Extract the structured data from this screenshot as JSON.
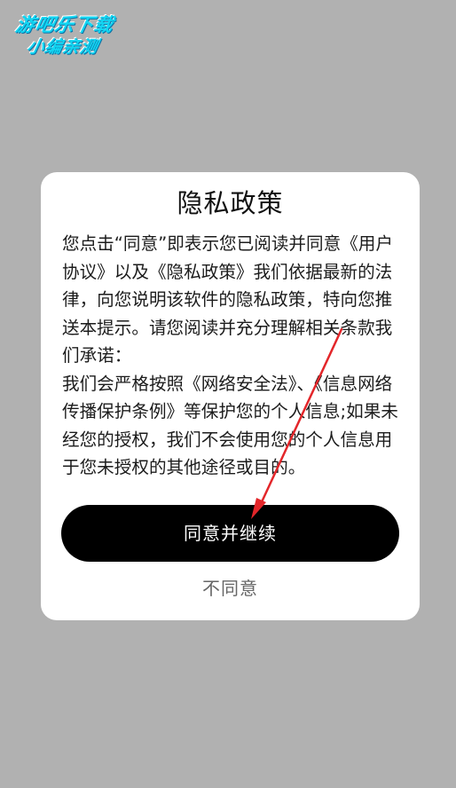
{
  "watermark": {
    "line1": "游吧乐下载",
    "line2": "小编亲测"
  },
  "dialog": {
    "title": "隐私政策",
    "paragraph1": "您点击“同意”即表示您已阅读并同意《用户协议》以及《隐私政策》我们依据最新的法律，向您说明该软件的隐私政策，特向您推送本提示。请您阅读并充分理解相关条款我们承诺：",
    "paragraph2": "我们会严格按照《网络安全法》、《信息网络传播保护条例》等保护您的个人信息;如果未经您的授权，我们不会使用您的个人信息用于您未授权的其他途径或目的。",
    "agree_label": "同意并继续",
    "disagree_label": "不同意"
  },
  "annotation": {
    "arrow_color": "#e3262a"
  }
}
